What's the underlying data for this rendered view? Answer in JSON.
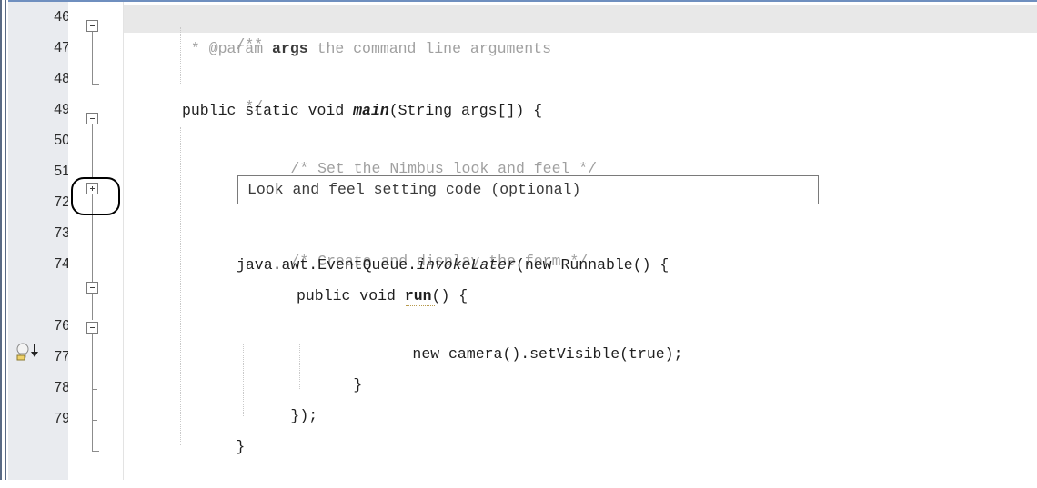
{
  "editor": {
    "line_numbers": [
      "46",
      "47",
      "48",
      "49",
      "50",
      "51",
      "72",
      "73",
      "74",
      "",
      "76",
      "77",
      "78",
      "79"
    ],
    "hint_icon": "lightbulb-hint-icon",
    "collapsed_fold_label": "Look and feel setting code (optional)",
    "lines": {
      "l46": "/**",
      "l47_a": " * @param ",
      "l47_b": "args",
      "l47_c": " the command line arguments",
      "l48": " */",
      "l49_a": "public static void ",
      "l49_b": "main",
      "l49_c": "(String args[]) {",
      "l50": "/* Set the Nimbus look and feel */",
      "l73": "/* Create and display the form */",
      "l74_a": "java.awt.EventQueue.",
      "l74_b": "invokeLater",
      "l74_c": "(new Runnable() {",
      "l75_a": "public void ",
      "l75_b": "run",
      "l75_c": "() {",
      "l76": "new camera().setVisible(true);",
      "l77": "}",
      "l78": "});",
      "l79": "}"
    }
  }
}
